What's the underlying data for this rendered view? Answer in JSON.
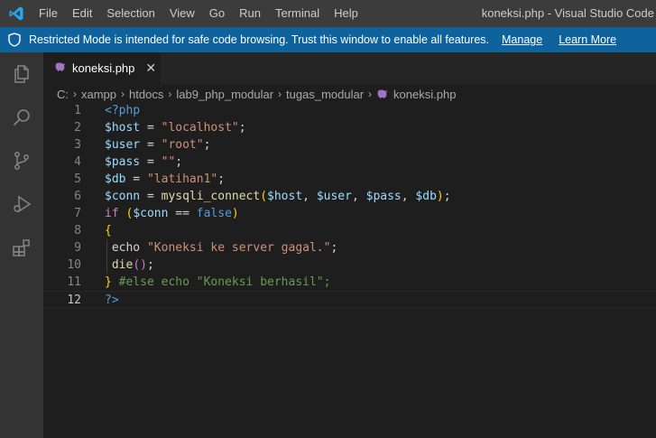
{
  "titlebar": {
    "menu": [
      "File",
      "Edit",
      "Selection",
      "View",
      "Go",
      "Run",
      "Terminal",
      "Help"
    ],
    "window_title": "koneksi.php - Visual Studio Code"
  },
  "banner": {
    "text": "Restricted Mode is intended for safe code browsing. Trust this window to enable all features.",
    "manage": "Manage",
    "learn_more": "Learn More"
  },
  "activity_icons": [
    "explorer-icon",
    "search-icon",
    "source-control-icon",
    "run-debug-icon",
    "extensions-icon"
  ],
  "tab": {
    "label": "koneksi.php",
    "close": "✕"
  },
  "breadcrumb": [
    "C:",
    "xampp",
    "htdocs",
    "lab9_php_modular",
    "tugas_modular",
    "koneksi.php"
  ],
  "editor": {
    "active_line": 12,
    "lines": [
      [
        [
          "tag",
          "<?php"
        ]
      ],
      [
        [
          "var",
          "$host"
        ],
        [
          "op",
          " = "
        ],
        [
          "str",
          "\"localhost\""
        ],
        [
          "op",
          ";"
        ]
      ],
      [
        [
          "var",
          "$user"
        ],
        [
          "op",
          " = "
        ],
        [
          "str",
          "\"root\""
        ],
        [
          "op",
          ";"
        ]
      ],
      [
        [
          "var",
          "$pass"
        ],
        [
          "op",
          " = "
        ],
        [
          "str",
          "\"\""
        ],
        [
          "op",
          ";"
        ]
      ],
      [
        [
          "var",
          "$db"
        ],
        [
          "op",
          " = "
        ],
        [
          "str",
          "\"latihan1\""
        ],
        [
          "op",
          ";"
        ]
      ],
      [
        [
          "var",
          "$conn"
        ],
        [
          "op",
          " = "
        ],
        [
          "fn",
          "mysqli_connect"
        ],
        [
          "brace",
          "("
        ],
        [
          "var",
          "$host"
        ],
        [
          "op",
          ", "
        ],
        [
          "var",
          "$user"
        ],
        [
          "op",
          ", "
        ],
        [
          "var",
          "$pass"
        ],
        [
          "op",
          ", "
        ],
        [
          "var",
          "$db"
        ],
        [
          "brace",
          ")"
        ],
        [
          "op",
          ";"
        ]
      ],
      [
        [
          "ctl",
          "if"
        ],
        [
          "op",
          " "
        ],
        [
          "brace",
          "("
        ],
        [
          "var",
          "$conn"
        ],
        [
          "op",
          " == "
        ],
        [
          "kw",
          "false"
        ],
        [
          "brace",
          ")"
        ]
      ],
      [
        [
          "brace",
          "{"
        ]
      ],
      [
        [
          "op",
          " echo "
        ],
        [
          "str",
          "\"Koneksi ke server gagal.\""
        ],
        [
          "op",
          ";"
        ]
      ],
      [
        [
          "op",
          " "
        ],
        [
          "fn",
          "die"
        ],
        [
          "paren",
          "()"
        ],
        [
          "op",
          ";"
        ]
      ],
      [
        [
          "brace",
          "}"
        ],
        [
          "op",
          " "
        ],
        [
          "com",
          "#else echo \"Koneksi berhasil\";"
        ]
      ],
      [
        [
          "tag",
          "?>"
        ]
      ]
    ]
  }
}
